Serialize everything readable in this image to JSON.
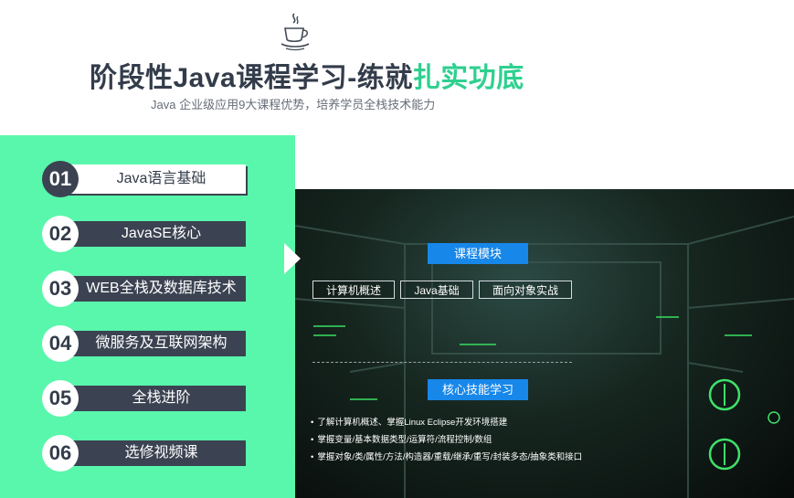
{
  "header": {
    "logo_icon": "java-coffee-cup-icon",
    "title_main": "阶段性Java课程学习-练就",
    "title_highlight": "扎实功底",
    "subtitle": "Java 企业级应用9大课程优势，培养学员全栈技术能力"
  },
  "nav": {
    "items": [
      {
        "num": "01",
        "label": "Java语言基础",
        "active": true
      },
      {
        "num": "02",
        "label": "JavaSE核心",
        "active": false
      },
      {
        "num": "03",
        "label": "WEB全栈及数据库技术",
        "active": false
      },
      {
        "num": "04",
        "label": "微服务及互联网架构",
        "active": false
      },
      {
        "num": "05",
        "label": "全栈进阶",
        "active": false
      },
      {
        "num": "06",
        "label": "选修视频课",
        "active": false
      }
    ]
  },
  "content": {
    "module_label": "课程模块",
    "module_tags": [
      "计算机概述",
      "Java基础",
      "面向对象实战"
    ],
    "skills_label": "核心技能学习",
    "skills": [
      "了解计算机概述、掌握Linux Eclipse开发环境搭建",
      "掌握变量/基本数据类型/运算符/流程控制/数组",
      "掌握对象/类/属性/方法/构造器/重载/继承/重写/封装多态/抽象类和接口"
    ]
  },
  "colors": {
    "green_panel": "#59f7ac",
    "dark_bar": "#3b4352",
    "highlight": "#2fd08f",
    "badge_blue": "#1787ea"
  }
}
